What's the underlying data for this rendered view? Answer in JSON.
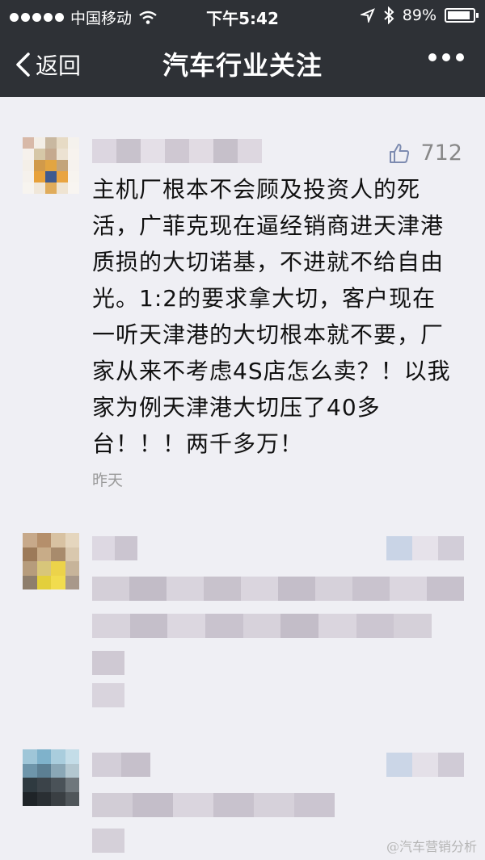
{
  "status_bar": {
    "carrier": "中国移动",
    "time": "下午5:42",
    "battery": "89%"
  },
  "nav": {
    "back_label": "返回",
    "title": "汽车行业关注"
  },
  "comments": [
    {
      "likes": "712",
      "text_lines": [
        "主机厂根本不会顾及投资人的死",
        "活，广菲克现在逼经销商进天津港",
        "质损的大切诺基，不进就不给自由",
        "光。1:2的要求拿大切，客户现在",
        "一听天津港的大切根本就不要，厂",
        "家从来不考虑4S店怎么卖？！以我",
        "家为例天津港大切压了40多",
        "台！！！两千多万！"
      ],
      "time": "昨天"
    }
  ],
  "watermark": "@汽车营销分析",
  "colors": {
    "topbar": "#2e3136",
    "page_bg": "#efeff4",
    "like_gray": "#888888"
  },
  "icons": [
    "signal-dots-icon",
    "wifi-icon",
    "location-icon",
    "bluetooth-icon",
    "battery-icon",
    "back-chevron-icon",
    "more-dots-icon",
    "thumbs-up-icon"
  ]
}
